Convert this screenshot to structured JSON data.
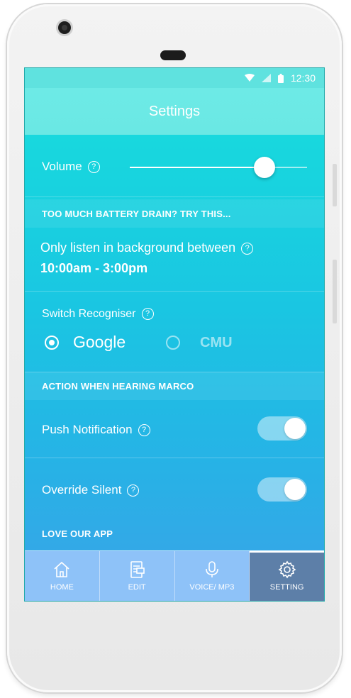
{
  "statusbar": {
    "time": "12:30",
    "icons": [
      "wifi-icon",
      "signal-icon",
      "battery-icon"
    ]
  },
  "header": {
    "title": "Settings"
  },
  "volume": {
    "label": "Volume",
    "help": "?",
    "level_percent": 76
  },
  "battery_section": {
    "header": "TOO MUCH BATTERY DRAIN? TRY THIS...",
    "listen_label": "Only listen in background between",
    "help": "?",
    "time_range": "10:00am - 3:00pm"
  },
  "recogniser": {
    "label": "Switch Recogniser",
    "help": "?",
    "options": [
      {
        "label": "Google",
        "selected": true
      },
      {
        "label": "CMU",
        "selected": false
      }
    ]
  },
  "action_section": {
    "header": "ACTION WHEN HEARING MARCO"
  },
  "push_notification": {
    "label": "Push Notification",
    "help": "?",
    "enabled": true
  },
  "override_silent": {
    "label": "Override Silent",
    "help": "?",
    "enabled": true
  },
  "love_section": {
    "header": "LOVE OUR APP"
  },
  "nav": {
    "items": [
      {
        "label": "HOME",
        "icon": "home-icon"
      },
      {
        "label": "EDIT",
        "icon": "edit-icon"
      },
      {
        "label": "VOICE/ MP3",
        "icon": "microphone-icon"
      },
      {
        "label": "SETTING",
        "icon": "gear-icon",
        "active": true
      }
    ]
  },
  "colors": {
    "accent": "#1ac6e2",
    "header": "#6ae8e4",
    "nav": "#8ec2f8",
    "nav_active": "#5d7fa8"
  }
}
